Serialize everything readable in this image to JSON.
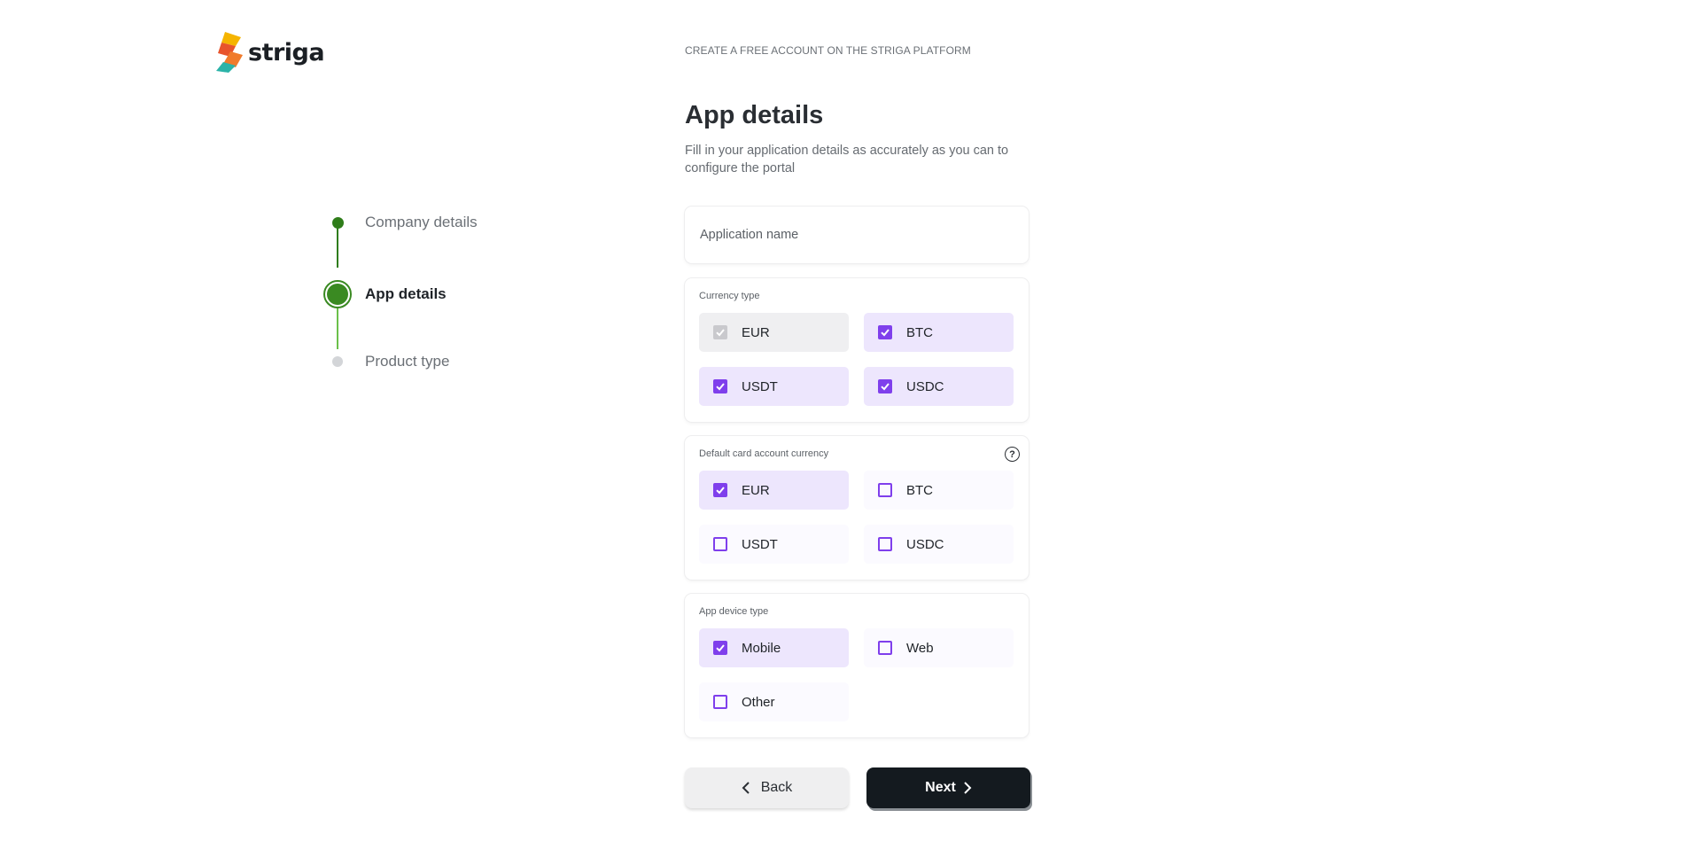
{
  "brand": {
    "name": "striga"
  },
  "stepper": {
    "steps": [
      {
        "label": "Company details",
        "state": "completed"
      },
      {
        "label": "App details",
        "state": "active"
      },
      {
        "label": "Product type",
        "state": "pending"
      }
    ]
  },
  "header": {
    "eyebrow": "CREATE A FREE ACCOUNT ON THE STRIGA PLATFORM",
    "title": "App details",
    "subtitle": "Fill in your application details as accurately as you can to configure the portal"
  },
  "form": {
    "app_name": {
      "placeholder": "Application name",
      "value": ""
    },
    "currency_type": {
      "label": "Currency type",
      "options": [
        {
          "label": "EUR",
          "checked": true,
          "disabled": true
        },
        {
          "label": "BTC",
          "checked": true
        },
        {
          "label": "USDT",
          "checked": true
        },
        {
          "label": "USDC",
          "checked": true
        }
      ]
    },
    "default_card_currency": {
      "label": "Default card account currency",
      "help_icon": "question-circle-icon",
      "options": [
        {
          "label": "EUR",
          "checked": true
        },
        {
          "label": "BTC",
          "checked": false
        },
        {
          "label": "USDT",
          "checked": false
        },
        {
          "label": "USDC",
          "checked": false
        }
      ]
    },
    "device_type": {
      "label": "App device type",
      "options": [
        {
          "label": "Mobile",
          "checked": true
        },
        {
          "label": "Web",
          "checked": false
        },
        {
          "label": "Other",
          "checked": false
        }
      ]
    }
  },
  "actions": {
    "back_label": "Back",
    "next_label": "Next"
  },
  "colors": {
    "accent": "#7f3fec",
    "step_green": "#3a8a22",
    "primary_button": "#141a1f"
  }
}
